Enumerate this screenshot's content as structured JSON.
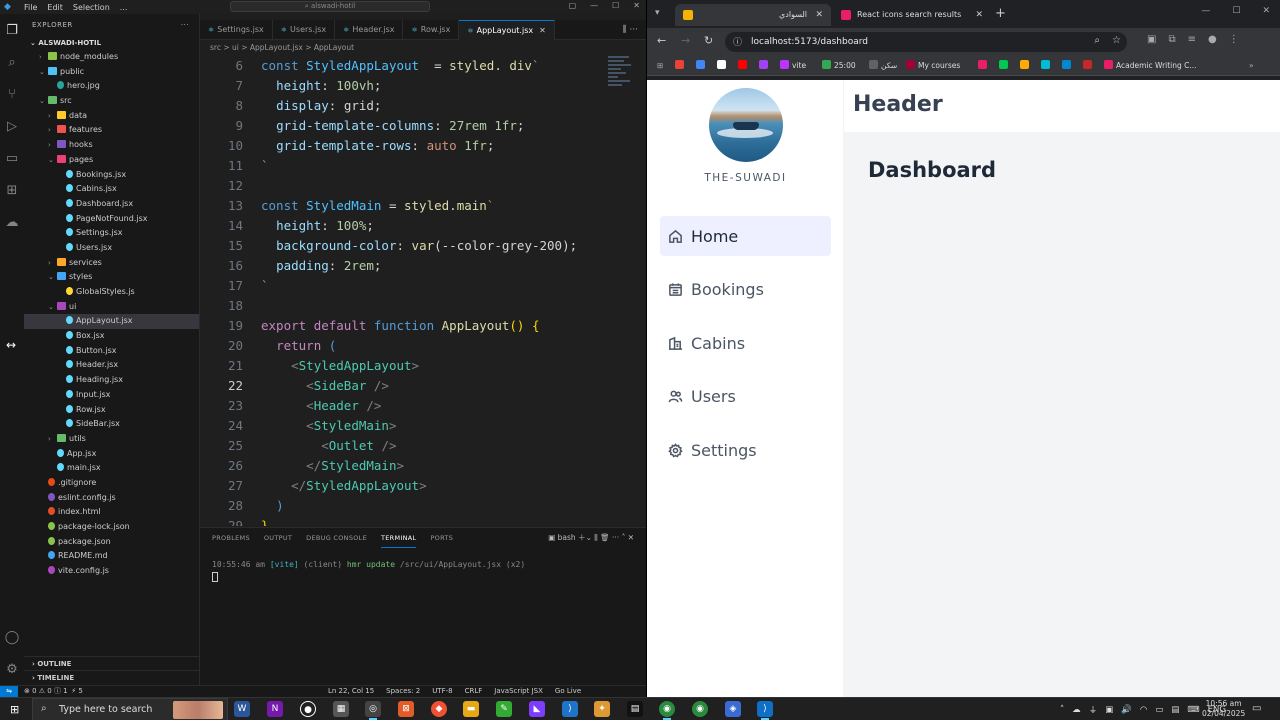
{
  "vscode": {
    "menu": [
      "File",
      "Edit",
      "Selection",
      "..."
    ],
    "search_text": "alswadi-hotil",
    "explorer_title": "EXPLORER",
    "root_folder": "ALSWADI-HOTIL",
    "tree": [
      {
        "label": "node_modules",
        "depth": 1,
        "type": "folder",
        "open": false,
        "color": "#8bc34a"
      },
      {
        "label": "public",
        "depth": 1,
        "type": "folder",
        "open": true,
        "color": "#4fc3f7"
      },
      {
        "label": "hero.jpg",
        "depth": 2,
        "type": "file",
        "color": "#26a69a"
      },
      {
        "label": "src",
        "depth": 1,
        "type": "folder",
        "open": true,
        "color": "#66bb6a"
      },
      {
        "label": "data",
        "depth": 2,
        "type": "folder",
        "open": false,
        "color": "#ffca28"
      },
      {
        "label": "features",
        "depth": 2,
        "type": "folder",
        "open": false,
        "color": "#ef5350"
      },
      {
        "label": "hooks",
        "depth": 2,
        "type": "folder",
        "open": false,
        "color": "#7e57c2"
      },
      {
        "label": "pages",
        "depth": 2,
        "type": "folder",
        "open": true,
        "color": "#ec407a"
      },
      {
        "label": "Bookings.jsx",
        "depth": 3,
        "type": "file",
        "color": "#61dafb"
      },
      {
        "label": "Cabins.jsx",
        "depth": 3,
        "type": "file",
        "color": "#61dafb"
      },
      {
        "label": "Dashboard.jsx",
        "depth": 3,
        "type": "file",
        "color": "#61dafb"
      },
      {
        "label": "PageNotFound.jsx",
        "depth": 3,
        "type": "file",
        "color": "#61dafb"
      },
      {
        "label": "Settings.jsx",
        "depth": 3,
        "type": "file",
        "color": "#61dafb"
      },
      {
        "label": "Users.jsx",
        "depth": 3,
        "type": "file",
        "color": "#61dafb"
      },
      {
        "label": "services",
        "depth": 2,
        "type": "folder",
        "open": false,
        "color": "#ffa726"
      },
      {
        "label": "styles",
        "depth": 2,
        "type": "folder",
        "open": true,
        "color": "#42a5f5"
      },
      {
        "label": "GlobalStyles.js",
        "depth": 3,
        "type": "file",
        "color": "#fdd835"
      },
      {
        "label": "ui",
        "depth": 2,
        "type": "folder",
        "open": true,
        "color": "#ab47bc"
      },
      {
        "label": "AppLayout.jsx",
        "depth": 3,
        "type": "file",
        "color": "#61dafb",
        "selected": true
      },
      {
        "label": "Box.jsx",
        "depth": 3,
        "type": "file",
        "color": "#61dafb"
      },
      {
        "label": "Button.jsx",
        "depth": 3,
        "type": "file",
        "color": "#61dafb"
      },
      {
        "label": "Header.jsx",
        "depth": 3,
        "type": "file",
        "color": "#61dafb"
      },
      {
        "label": "Heading.jsx",
        "depth": 3,
        "type": "file",
        "color": "#61dafb"
      },
      {
        "label": "Input.jsx",
        "depth": 3,
        "type": "file",
        "color": "#61dafb"
      },
      {
        "label": "Row.jsx",
        "depth": 3,
        "type": "file",
        "color": "#61dafb"
      },
      {
        "label": "SideBar.jsx",
        "depth": 3,
        "type": "file",
        "color": "#61dafb"
      },
      {
        "label": "utils",
        "depth": 2,
        "type": "folder",
        "open": false,
        "color": "#66bb6a"
      },
      {
        "label": "App.jsx",
        "depth": 2,
        "type": "file",
        "color": "#61dafb"
      },
      {
        "label": "main.jsx",
        "depth": 2,
        "type": "file",
        "color": "#61dafb"
      },
      {
        "label": ".gitignore",
        "depth": 1,
        "type": "file",
        "color": "#e64a19"
      },
      {
        "label": "eslint.config.js",
        "depth": 1,
        "type": "file",
        "color": "#7e57c2"
      },
      {
        "label": "index.html",
        "depth": 1,
        "type": "file",
        "color": "#e44d26"
      },
      {
        "label": "package-lock.json",
        "depth": 1,
        "type": "file",
        "color": "#8bc34a"
      },
      {
        "label": "package.json",
        "depth": 1,
        "type": "file",
        "color": "#8bc34a"
      },
      {
        "label": "README.md",
        "depth": 1,
        "type": "file",
        "color": "#42a5f5"
      },
      {
        "label": "vite.config.js",
        "depth": 1,
        "type": "file",
        "color": "#ab47bc"
      }
    ],
    "sections": {
      "outline": "OUTLINE",
      "timeline": "TIMELINE"
    },
    "tabs": [
      {
        "label": "Settings.jsx",
        "active": false
      },
      {
        "label": "Users.jsx",
        "active": false
      },
      {
        "label": "Header.jsx",
        "active": false
      },
      {
        "label": "Row.jsx",
        "active": false
      },
      {
        "label": "AppLayout.jsx",
        "active": true
      }
    ],
    "breadcrumb": "src  >  ui  >  AppLayout.jsx  >  AppLayout",
    "code_lines": [
      {
        "n": "6",
        "t": [
          [
            "kw",
            "const "
          ],
          [
            "vr",
            "StyledAppLayout"
          ],
          [
            "",
            "  = "
          ],
          [
            "fn",
            "styled"
          ],
          [
            "",
            ". "
          ],
          [
            "fn",
            "div"
          ],
          [
            "st",
            "`"
          ]
        ]
      },
      {
        "n": "7",
        "t": [
          [
            "",
            "  "
          ],
          [
            "pr",
            "height"
          ],
          [
            "",
            ": "
          ],
          [
            "nm",
            "100vh"
          ],
          [
            "",
            ";"
          ]
        ]
      },
      {
        "n": "8",
        "t": [
          [
            "",
            "  "
          ],
          [
            "pr",
            "display"
          ],
          [
            "",
            ": "
          ],
          [
            "",
            "grid"
          ],
          [
            "",
            ";"
          ]
        ]
      },
      {
        "n": "9",
        "t": [
          [
            "",
            "  "
          ],
          [
            "pr",
            "grid-template-columns"
          ],
          [
            "",
            ": "
          ],
          [
            "nm",
            "27rem"
          ],
          [
            "",
            " "
          ],
          [
            "nm",
            "1fr"
          ],
          [
            "",
            ";"
          ]
        ]
      },
      {
        "n": "10",
        "t": [
          [
            "",
            "  "
          ],
          [
            "pr",
            "grid-template-rows"
          ],
          [
            "",
            ": "
          ],
          [
            "st",
            "auto"
          ],
          [
            "",
            " "
          ],
          [
            "nm",
            "1fr"
          ],
          [
            "",
            ";"
          ]
        ]
      },
      {
        "n": "11",
        "t": [
          [
            "st",
            "`"
          ]
        ]
      },
      {
        "n": "12",
        "t": [
          [
            "",
            ""
          ]
        ]
      },
      {
        "n": "13",
        "t": [
          [
            "kw",
            "const "
          ],
          [
            "vr",
            "StyledMain"
          ],
          [
            "",
            " = "
          ],
          [
            "fn",
            "styled"
          ],
          [
            "",
            "."
          ],
          [
            "fn",
            "main"
          ],
          [
            "st",
            "`"
          ]
        ]
      },
      {
        "n": "14",
        "t": [
          [
            "",
            "  "
          ],
          [
            "pr",
            "height"
          ],
          [
            "",
            ": "
          ],
          [
            "nm",
            "100%"
          ],
          [
            "",
            ";"
          ]
        ]
      },
      {
        "n": "15",
        "t": [
          [
            "",
            "  "
          ],
          [
            "pr",
            "background-color"
          ],
          [
            "",
            ": "
          ],
          [
            "fn",
            "var"
          ],
          [
            "",
            "("
          ],
          [
            "",
            "--color-grey-200"
          ],
          [
            "",
            ");"
          ]
        ]
      },
      {
        "n": "16",
        "t": [
          [
            "",
            "  "
          ],
          [
            "pr",
            "padding"
          ],
          [
            "",
            ": "
          ],
          [
            "nm",
            "2rem"
          ],
          [
            "",
            ";"
          ]
        ]
      },
      {
        "n": "17",
        "t": [
          [
            "st",
            "`"
          ]
        ]
      },
      {
        "n": "18",
        "t": [
          [
            "",
            ""
          ]
        ]
      },
      {
        "n": "19",
        "t": [
          [
            "kw2",
            "export "
          ],
          [
            "kw2",
            "default "
          ],
          [
            "kw",
            "function "
          ],
          [
            "fn",
            "AppLayout"
          ],
          [
            "pn",
            "() "
          ],
          [
            "pn",
            "{"
          ]
        ]
      },
      {
        "n": "20",
        "t": [
          [
            "",
            "  "
          ],
          [
            "kw2",
            "return "
          ],
          [
            "kw",
            "("
          ]
        ]
      },
      {
        "n": "21",
        "t": [
          [
            "",
            "    "
          ],
          [
            "br",
            "<"
          ],
          [
            "tg",
            "StyledAppLayout"
          ],
          [
            "br",
            ">"
          ]
        ]
      },
      {
        "n": "22",
        "t": [
          [
            "",
            "      "
          ],
          [
            "br",
            "<"
          ],
          [
            "tg",
            "SideBar"
          ],
          [
            "",
            " "
          ],
          [
            "br",
            "/>"
          ]
        ],
        "current": true
      },
      {
        "n": "23",
        "t": [
          [
            "",
            "      "
          ],
          [
            "br",
            "<"
          ],
          [
            "tg",
            "Header"
          ],
          [
            "",
            " "
          ],
          [
            "br",
            "/>"
          ]
        ]
      },
      {
        "n": "24",
        "t": [
          [
            "",
            "      "
          ],
          [
            "br",
            "<"
          ],
          [
            "tg",
            "StyledMain"
          ],
          [
            "br",
            ">"
          ]
        ]
      },
      {
        "n": "25",
        "t": [
          [
            "",
            "        "
          ],
          [
            "br",
            "<"
          ],
          [
            "tg",
            "Outlet"
          ],
          [
            "",
            " "
          ],
          [
            "br",
            "/>"
          ]
        ]
      },
      {
        "n": "26",
        "t": [
          [
            "",
            "      "
          ],
          [
            "br",
            "</"
          ],
          [
            "tg",
            "StyledMain"
          ],
          [
            "br",
            ">"
          ]
        ]
      },
      {
        "n": "27",
        "t": [
          [
            "",
            "    "
          ],
          [
            "br",
            "</"
          ],
          [
            "tg",
            "StyledAppLayout"
          ],
          [
            "br",
            ">"
          ]
        ]
      },
      {
        "n": "28",
        "t": [
          [
            "",
            "  "
          ],
          [
            "kw",
            ")"
          ]
        ]
      },
      {
        "n": "29",
        "t": [
          [
            "pn",
            "}"
          ]
        ]
      }
    ],
    "panel_tabs": [
      "PROBLEMS",
      "OUTPUT",
      "DEBUG CONSOLE",
      "TERMINAL",
      "PORTS"
    ],
    "panel_active": "TERMINAL",
    "terminal_shell": "bash",
    "terminal_line": {
      "time": "10:55:46 am",
      "tag": "[vite]",
      "client": "(client)",
      "msg": "hmr update",
      "path": "/src/ui/AppLayout.jsx",
      "count": "(x2)"
    },
    "status": {
      "left": "⊗ 0 ⚠ 0  ⓘ 1   ⚡ 5",
      "cursor": "Ln 22, Col 15",
      "spaces": "Spaces: 2",
      "encoding": "UTF-8",
      "eol": "CRLF",
      "lang": "JavaScript JSX",
      "golive": "Go Live"
    }
  },
  "chrome": {
    "tabs": [
      {
        "label": "السوادي",
        "active": true
      },
      {
        "label": "React icons search results",
        "active": false
      }
    ],
    "url": "localhost:5173/dashboard",
    "bookmarks": [
      {
        "label": "",
        "color": "#ea4335"
      },
      {
        "label": "",
        "color": "#4285f4"
      },
      {
        "label": "",
        "color": "#ffffff"
      },
      {
        "label": "",
        "color": "#ff0000"
      },
      {
        "label": "",
        "color": "#a142f4"
      },
      {
        "label": "vite",
        "color": "#bd34fe"
      },
      {
        "label": "25:00",
        "color": "#34a853"
      },
      {
        "label": "سكن",
        "color": "#5f6368"
      },
      {
        "label": "My courses",
        "color": "#a50034"
      },
      {
        "label": "",
        "color": "#e91e63"
      },
      {
        "label": "",
        "color": "#00c853"
      },
      {
        "label": "",
        "color": "#ffab00"
      },
      {
        "label": "",
        "color": "#00bcd4"
      },
      {
        "label": "",
        "color": "#0288d1"
      },
      {
        "label": "",
        "color": "#c62828"
      },
      {
        "label": "Academic Writing C...",
        "color": "#e91e63"
      }
    ],
    "page": {
      "brand": "THE-SUWADI",
      "header": "Header",
      "main_title": "Dashboard",
      "nav": [
        {
          "label": "Home",
          "icon": "home-icon",
          "active": true
        },
        {
          "label": "Bookings",
          "icon": "calendar-icon",
          "active": false
        },
        {
          "label": "Cabins",
          "icon": "building-icon",
          "active": false
        },
        {
          "label": "Users",
          "icon": "users-icon",
          "active": false
        },
        {
          "label": "Settings",
          "icon": "cog-icon",
          "active": false
        }
      ]
    }
  },
  "taskbar": {
    "search_placeholder": "Type here to search",
    "tray_lang": "ENG",
    "time": "10:56 am",
    "date": "02/04/2025"
  }
}
